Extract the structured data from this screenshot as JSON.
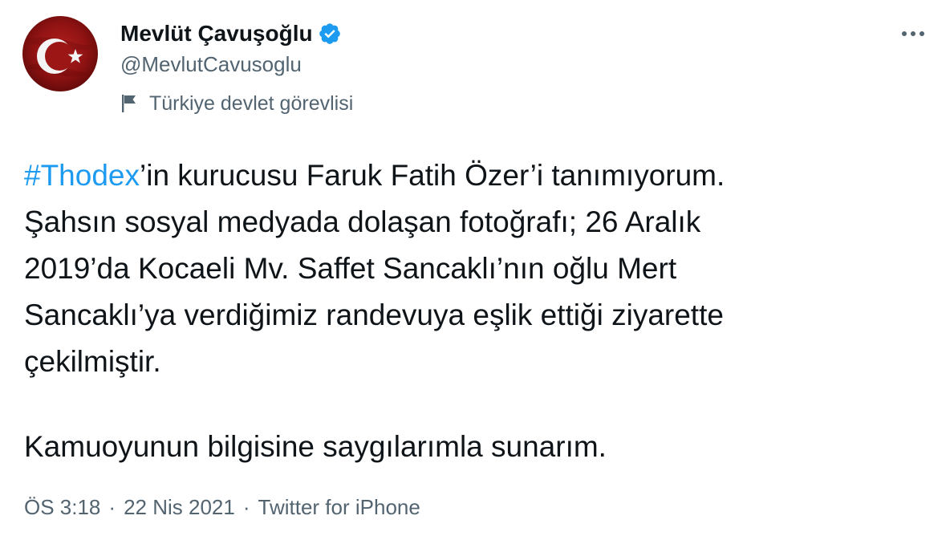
{
  "author": {
    "display_name": "Mevlüt Çavuşoğlu",
    "handle": "@MevlutCavusoglu",
    "verified_icon": "verified-badge-icon",
    "affiliation_icon": "flag-icon",
    "affiliation_label": "Türkiye devlet görevlisi"
  },
  "header": {
    "more_icon": "more-options-icon"
  },
  "tweet": {
    "hashtag": "#Thodex",
    "line1_rest": "’in kurucusu Faruk Fatih Özer’i tanımıyorum.",
    "line2": "Şahsın sosyal medyada dolaşan fotoğrafı; 26 Aralık",
    "line3": "2019’da Kocaeli Mv. Saffet Sancaklı’nın oğlu Mert",
    "line4": "Sancaklı’ya verdiğimiz randevuya eşlik ettiği ziyarette",
    "line5": "çekilmiştir.",
    "closing": "Kamuoyunun bilgisine saygılarımla sunarım."
  },
  "meta": {
    "time": "ÖS 3:18",
    "separator": "·",
    "date": "22 Nis 2021",
    "source": "Twitter for iPhone"
  },
  "colors": {
    "link": "#1d9bf0",
    "verified": "#1d9bf0",
    "secondary_text": "#536471",
    "primary_text": "#0f1419",
    "avatar_red": "#9a1414"
  }
}
